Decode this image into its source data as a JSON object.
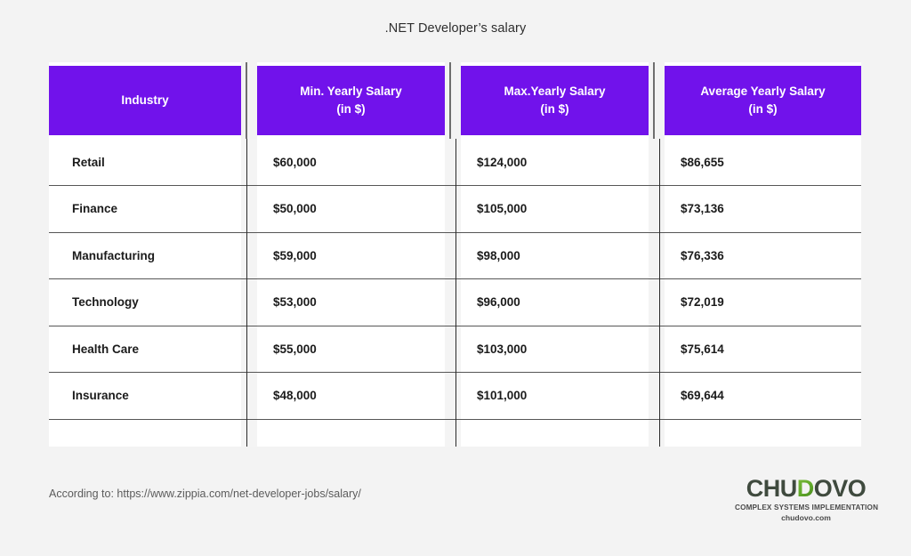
{
  "document": {
    "title": ".NET Developer’s salary",
    "background_color": "#f3f3f3",
    "accent_color": "#7112eb"
  },
  "table": {
    "headers": [
      {
        "line1": "Industry",
        "line2": ""
      },
      {
        "line1": "Min. Yearly Salary",
        "line2": "(in $)"
      },
      {
        "line1": "Max.Yearly Salary",
        "line2": "(in $)"
      },
      {
        "line1": "Average Yearly Salary",
        "line2": "(in $)"
      }
    ],
    "rows": [
      {
        "industry": "Retail",
        "min": "$60,000",
        "max": "$124,000",
        "avg": "$86,655"
      },
      {
        "industry": "Finance",
        "min": "$50,000",
        "max": "$105,000",
        "avg": "$73,136"
      },
      {
        "industry": "Manufacturing",
        "min": "$59,000",
        "max": "$98,000",
        "avg": "$76,336"
      },
      {
        "industry": "Technology",
        "min": "$53,000",
        "max": "$96,000",
        "avg": "$72,019"
      },
      {
        "industry": "Health Care",
        "min": "$55,000",
        "max": "$103,000",
        "avg": "$75,614"
      },
      {
        "industry": "Insurance",
        "min": "$48,000",
        "max": "$101,000",
        "avg": "$69,644"
      },
      {
        "industry": "",
        "min": "",
        "max": "",
        "avg": ""
      }
    ]
  },
  "footer": {
    "source": "According to: https://www.zippia.com/net-developer-jobs/salary/"
  },
  "logo": {
    "part1": "CHU",
    "part_green": "D",
    "part2": "OVO",
    "tagline": "COMPLEX SYSTEMS IMPLEMENTATION",
    "site": "chudovo.com",
    "green": "#5fa829"
  },
  "chart_data": {
    "type": "table",
    "title": ".NET Developer’s salary",
    "columns": [
      "Industry",
      "Min. Yearly Salary (in $)",
      "Max.Yearly Salary (in $)",
      "Average Yearly Salary (in $)"
    ],
    "categories": [
      "Retail",
      "Finance",
      "Manufacturing",
      "Technology",
      "Health Care",
      "Insurance"
    ],
    "series": [
      {
        "name": "Min. Yearly Salary (in $)",
        "values": [
          60000,
          50000,
          59000,
          53000,
          55000,
          48000
        ]
      },
      {
        "name": "Max.Yearly Salary (in $)",
        "values": [
          124000,
          105000,
          98000,
          96000,
          103000,
          101000
        ]
      },
      {
        "name": "Average Yearly Salary (in $)",
        "values": [
          86655,
          73136,
          76336,
          72019,
          75614,
          69644
        ]
      }
    ],
    "source": "According to: https://www.zippia.com/net-developer-jobs/salary/"
  }
}
